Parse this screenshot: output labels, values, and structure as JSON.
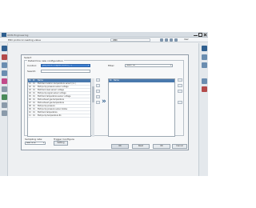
{
  "app": {
    "name": "ODIS Engineering",
    "window_title": "ODIS Engineering"
  },
  "topbar": {
    "title": "EDC protocol reading value",
    "status": "OBD",
    "user": "User"
  },
  "dialog": {
    "title": "Select",
    "group_title": "Determine new configuration",
    "control_label": "Control:",
    "control_value": "[00] EDC17 Engine control (...)",
    "search_label": "Search:",
    "search_value": "",
    "filter_label": "Filter:",
    "filter_value": "Select all",
    "columns": [
      "Nr",
      "ID",
      "Name"
    ],
    "rows": [
      {
        "nr": "01",
        "id": "01",
        "name": "EGR Recirculation temperature sensor (no.)"
      },
      {
        "nr": "02",
        "id": "01",
        "name": "EGR pump pressure sensor voltage"
      },
      {
        "nr": "03",
        "id": "01",
        "name": "EGR tank level sensor voltage"
      },
      {
        "nr": "04",
        "id": "01",
        "name": "EGR pump signal sensor voltage"
      },
      {
        "nr": "05",
        "id": "01",
        "name": "EGR tank temperature sensor voltage"
      },
      {
        "nr": "06",
        "id": "01",
        "name": "EGR exhaust gas temperature"
      },
      {
        "nr": "07",
        "id": "01",
        "name": "EGR exhaust gas temperature"
      },
      {
        "nr": "08",
        "id": "01",
        "name": "EGR pump pressure"
      },
      {
        "nr": "09",
        "id": "01",
        "name": "EGR pump pressure sensor status"
      },
      {
        "nr": "10",
        "id": "01",
        "name": "EGR tank temperature"
      },
      {
        "nr": "11",
        "id": "01",
        "name": "EGR pump temperature R1"
      }
    ],
    "right_columns": [
      "Nr",
      "Name"
    ],
    "sampling_label": "Sampling rate:",
    "sampling_value": "Real time",
    "trigger_label": "Trigger Configure",
    "trigger_button": "Setting",
    "buttons": {
      "ok": "OK",
      "read": "Read",
      "cancel": "Cancel"
    }
  }
}
